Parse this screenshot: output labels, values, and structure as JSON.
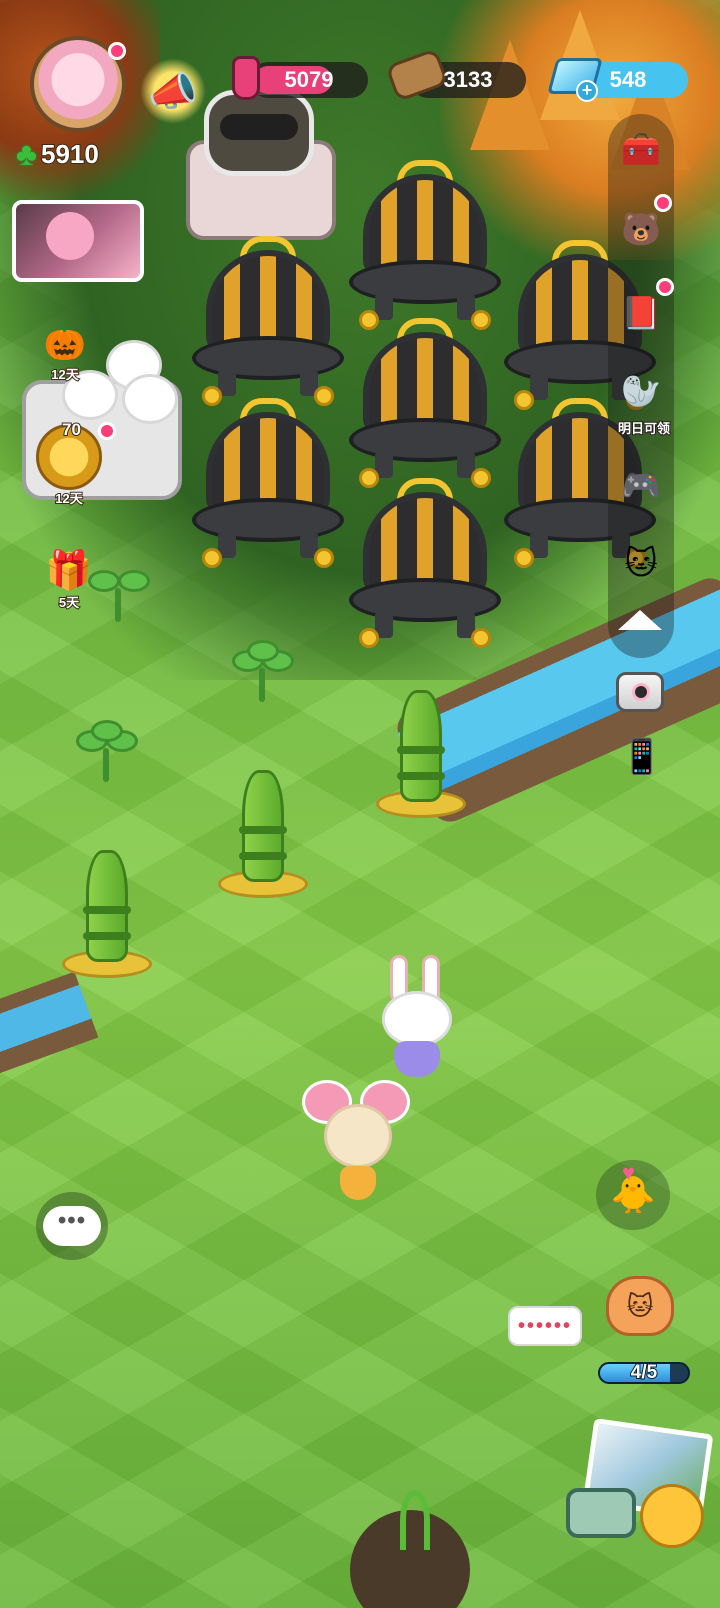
{
  "hud": {
    "clover_score": "5910",
    "resources": {
      "potion": "5079",
      "wood": "3133",
      "gems": "548"
    },
    "gem_plus": "+"
  },
  "left_events": {
    "halloween_days": "12天",
    "gold_count": "70",
    "gold_days": "12天",
    "gift_days": "5天"
  },
  "side_panel": {
    "tomorrow_label": "明日可领"
  },
  "chat": {
    "ellipsis": "•••",
    "speech_bubble": "••••••"
  },
  "visitor_progress": {
    "text": "4/5",
    "value": 0.8
  },
  "icons": {
    "clover": "clover-icon",
    "horn": "megaphone-icon",
    "potion": "potion-icon",
    "wood": "log-icon",
    "gem": "gem-icon"
  },
  "colors": {
    "grass": "#76c142",
    "potion_bar": "#e8417a",
    "gem_bar": "#46c4ef",
    "notification": "#ff3d7a"
  }
}
